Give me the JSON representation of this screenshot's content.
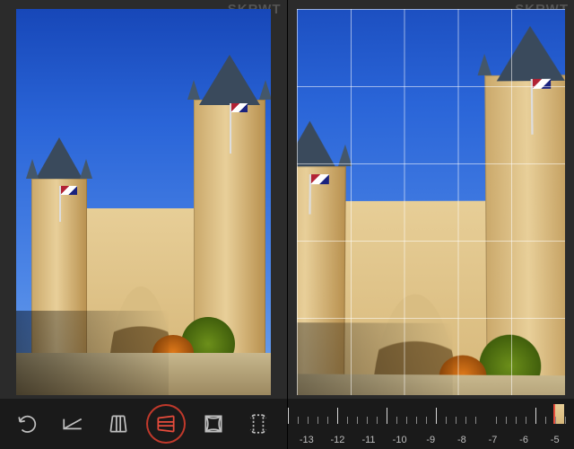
{
  "app": {
    "watermark": "SKRWT"
  },
  "left_pane": {
    "toolbar": {
      "undo": {
        "name": "undo-icon"
      },
      "horizon": {
        "name": "horizon-correction-icon"
      },
      "vertical_persp": {
        "name": "vertical-perspective-icon"
      },
      "horizontal_persp": {
        "name": "horizontal-perspective-icon",
        "selected": true
      },
      "lens_correction": {
        "name": "lens-correction-icon"
      },
      "crop_aspect": {
        "name": "crop-aspect-icon"
      }
    }
  },
  "right_pane": {
    "grid_visible": true,
    "ruler": {
      "labels": [
        "-13",
        "-12",
        "-11",
        "-10",
        "-9",
        "-8",
        "-7",
        "-6",
        "-5"
      ],
      "center_value": "-9.0"
    }
  },
  "colors": {
    "accent": "#e74c3c",
    "bg": "#1a1a1a",
    "panel": "#2b2b2b",
    "tick": "#bfbfbf"
  }
}
